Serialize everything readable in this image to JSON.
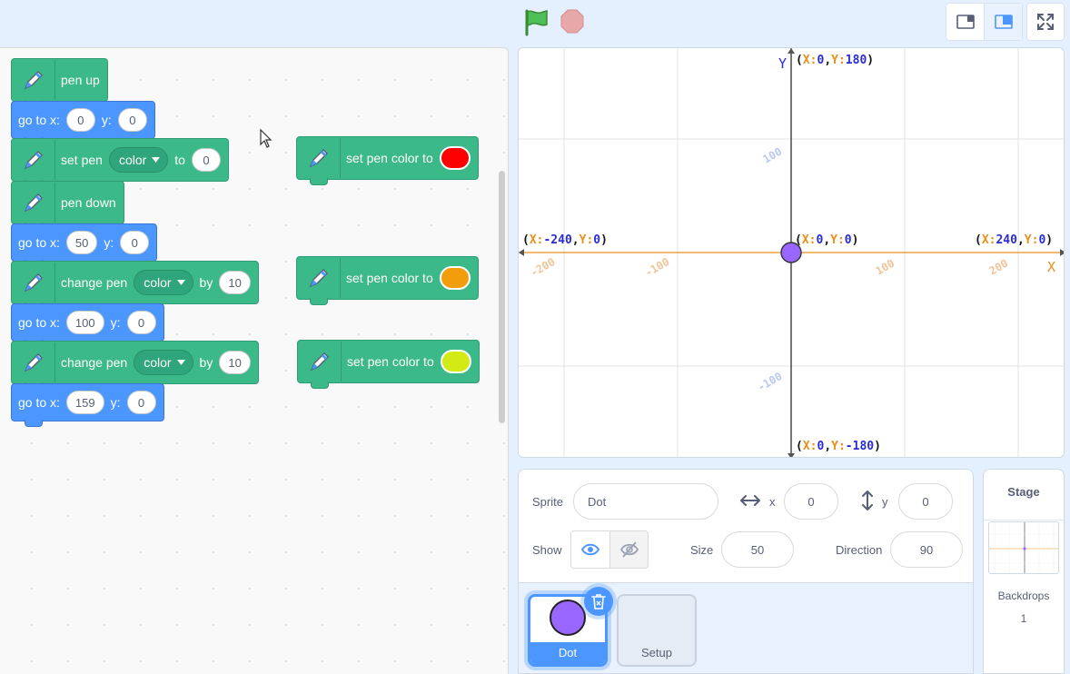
{
  "toolbar": {
    "green_flag": "green-flag-icon",
    "stop": "stop-icon",
    "layout_small": "small-stage-icon",
    "layout_normal": "normal-stage-icon",
    "fullscreen": "fullscreen-icon"
  },
  "blocks": {
    "b1": {
      "label": "pen up"
    },
    "b2": {
      "label_x": "go to x:",
      "x": "0",
      "label_y": "y:",
      "y": "0"
    },
    "b3": {
      "label": "set pen",
      "dropdown": "color",
      "to": "to",
      "value": "0"
    },
    "b4": {
      "label": "pen down"
    },
    "b5": {
      "label_x": "go to x:",
      "x": "50",
      "label_y": "y:",
      "y": "0"
    },
    "b6": {
      "label": "change pen",
      "dropdown": "color",
      "by": "by",
      "value": "10"
    },
    "b7": {
      "label_x": "go to x:",
      "x": "100",
      "label_y": "y:",
      "y": "0"
    },
    "b8": {
      "label": "change pen",
      "dropdown": "color",
      "by": "by",
      "value": "10"
    },
    "b9": {
      "label_x": "go to x:",
      "x": "159",
      "label_y": "y:",
      "y": "0"
    },
    "c1": {
      "label": "set pen color to",
      "color": "#ff0000"
    },
    "c2": {
      "label": "set pen color to",
      "color": "#f29d0b"
    },
    "c3": {
      "label": "set pen color to",
      "color": "#d4ea14"
    }
  },
  "stage": {
    "y_axis": "Y",
    "x_axis": "X",
    "top": {
      "open": "(",
      "xk": "X:",
      "xv": "0",
      "sep": ",",
      "yk": "Y:",
      "yv": "180",
      "close": ")"
    },
    "bottom": {
      "open": "(",
      "xk": "X:",
      "xv": "0",
      "sep": ",",
      "yk": "Y:",
      "yv": "-180",
      "close": ")"
    },
    "left": {
      "open": "(",
      "xk": "X:",
      "xv": "-240",
      "sep": ",",
      "yk": "Y:",
      "yv": "0",
      "close": ")"
    },
    "right": {
      "open": "(",
      "xk": "X:",
      "xv": "240",
      "sep": ",",
      "yk": "Y:",
      "yv": "0",
      "close": ")"
    },
    "center": {
      "open": "(",
      "xk": "X:",
      "xv": "0",
      "sep": ",",
      "yk": "Y:",
      "yv": "0",
      "close": ")"
    },
    "ticks": {
      "x_neg200": "-200",
      "x_neg100": "-100",
      "x_100": "100",
      "x_200": "200",
      "y_100": "100",
      "y_neg100": "-100"
    },
    "colors": {
      "x_axis": "#e8901a",
      "y_axis": "#1d1d1d",
      "key_orange": "#e8901a",
      "key_blue": "#2a2ad8",
      "sprite": "#9966ff"
    }
  },
  "sprite_info": {
    "sprite_label": "Sprite",
    "sprite_name": "Dot",
    "x_label": "x",
    "x_value": "0",
    "y_label": "y",
    "y_value": "0",
    "show_label": "Show",
    "size_label": "Size",
    "size_value": "50",
    "direction_label": "Direction",
    "direction_value": "90"
  },
  "sprites": [
    {
      "name": "Dot",
      "selected": true
    },
    {
      "name": "Setup",
      "selected": false
    }
  ],
  "stage_panel": {
    "title": "Stage",
    "backdrops_label": "Backdrops",
    "backdrops_count": "1"
  }
}
